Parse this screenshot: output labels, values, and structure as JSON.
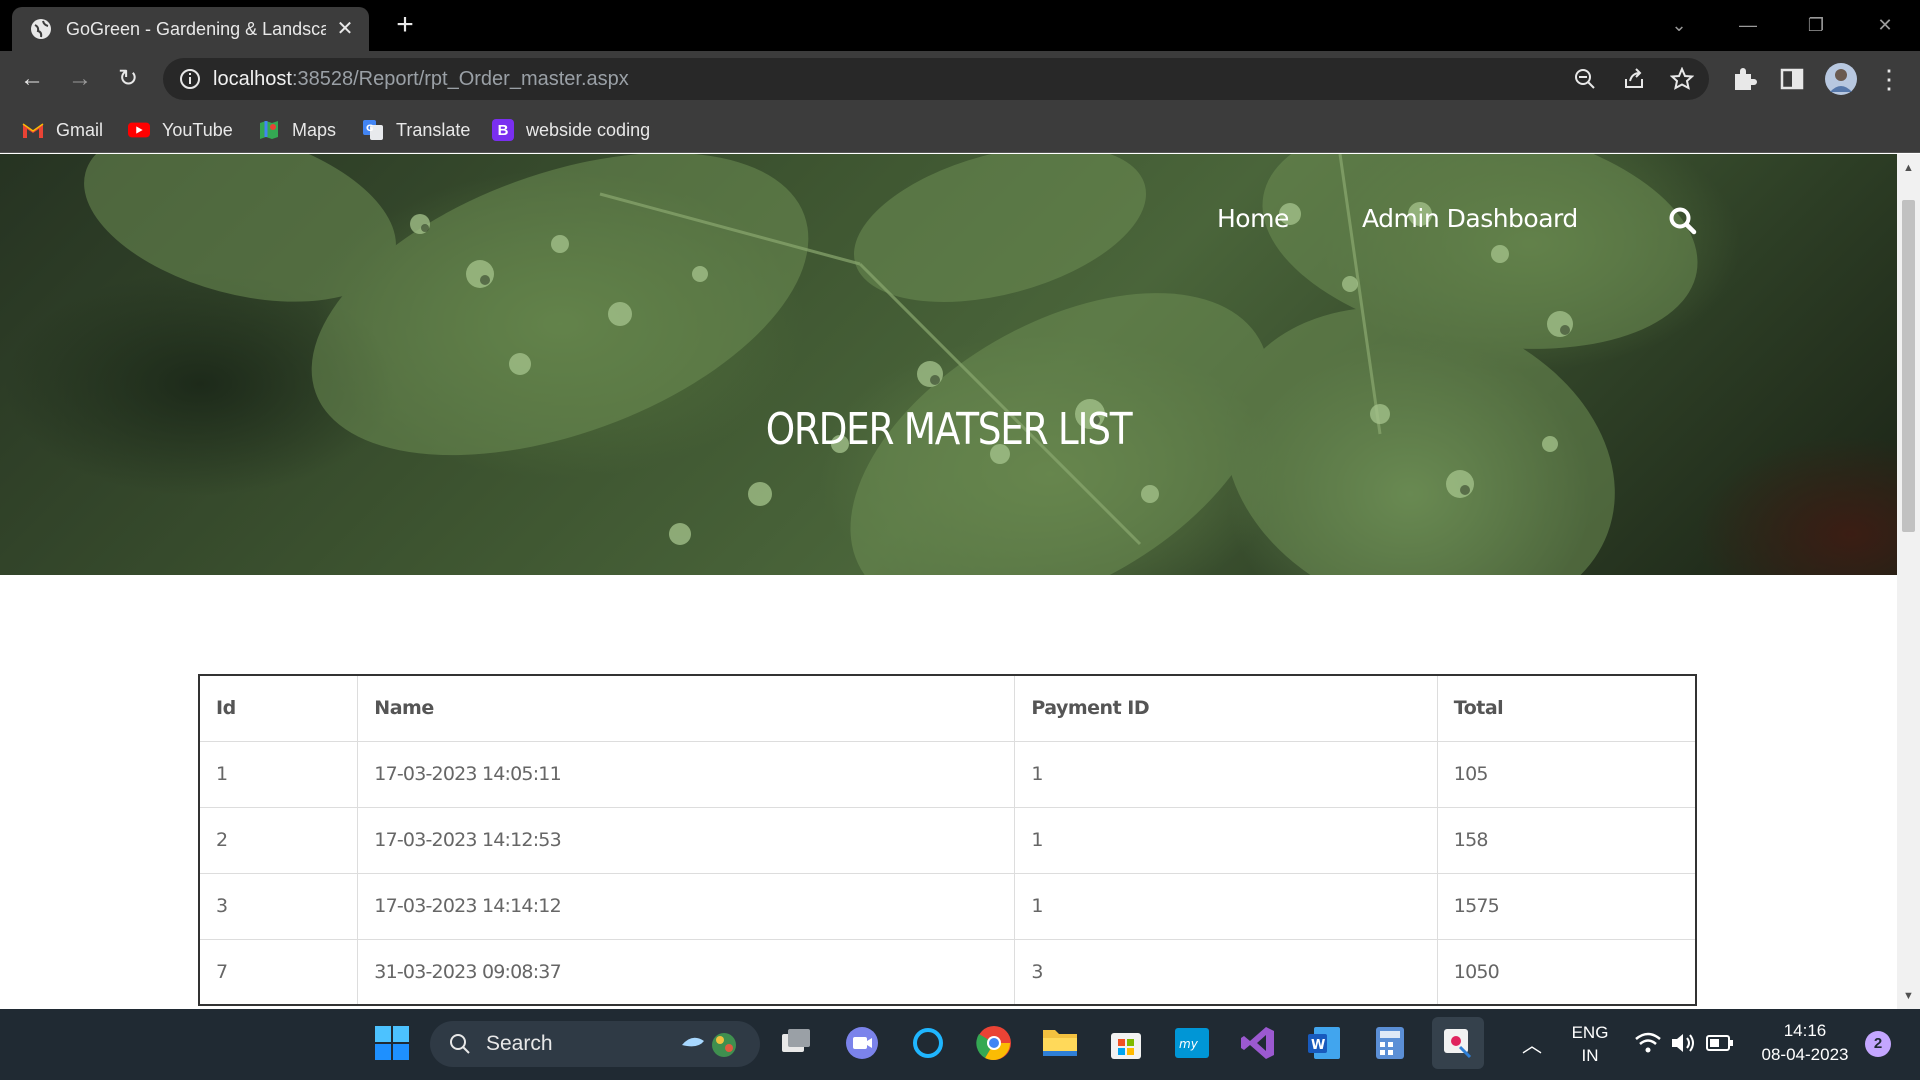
{
  "browser": {
    "tab_title": "GoGreen - Gardening & Landscaping",
    "url_host": "localhost",
    "url_path": ":38528/Report/rpt_Order_master.aspx",
    "bookmarks": [
      {
        "label": "Gmail",
        "icon": "gmail-icon"
      },
      {
        "label": "YouTube",
        "icon": "youtube-icon"
      },
      {
        "label": "Maps",
        "icon": "maps-icon"
      },
      {
        "label": "Translate",
        "icon": "translate-icon"
      },
      {
        "label": "webside coding",
        "icon": "bootstrap-icon"
      }
    ]
  },
  "site": {
    "nav": {
      "home": "Home",
      "admin": "Admin Dashboard"
    },
    "title": "ORDER MATSER LIST"
  },
  "table": {
    "headers": [
      "Id",
      "Name",
      "Payment ID",
      "Total"
    ],
    "rows": [
      [
        "1",
        "17-03-2023 14:05:11",
        "1",
        "105"
      ],
      [
        "2",
        "17-03-2023 14:12:53",
        "1",
        "158"
      ],
      [
        "3",
        "17-03-2023 14:14:12",
        "1",
        "1575"
      ],
      [
        "7",
        "31-03-2023 09:08:37",
        "3",
        "1050"
      ]
    ]
  },
  "taskbar": {
    "search_label": "Search",
    "lang_1": "ENG",
    "lang_2": "IN",
    "time": "14:16",
    "date": "08-04-2023",
    "notification_count": "2"
  },
  "colors": {
    "chrome_dark": "#3c3c3c",
    "taskbar": "#202a33",
    "table_border": "#333333"
  }
}
